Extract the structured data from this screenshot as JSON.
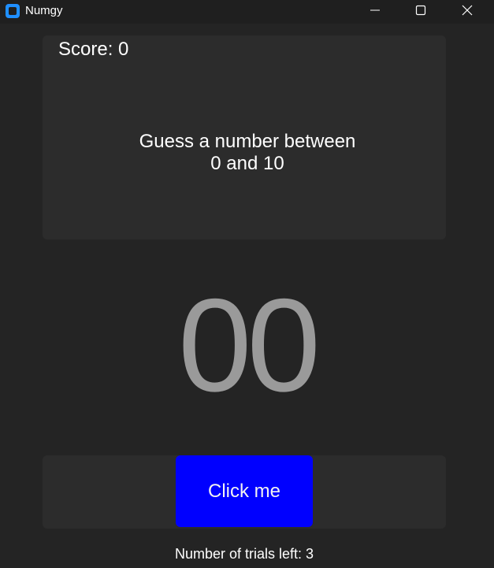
{
  "window": {
    "title": "Numgy",
    "controls": {
      "minimize_icon": "minimize-icon",
      "maximize_icon": "maximize-icon",
      "close_icon": "close-icon"
    }
  },
  "game": {
    "score_text": "Score: 0",
    "prompt_line1": "Guess a number between",
    "prompt_line2": "0 and 10",
    "number_display": "00",
    "button_label": "Click me",
    "trials_text": "Number of trials left: 3"
  },
  "colors": {
    "background": "#242424",
    "panel": "#2c2c2c",
    "button": "#0000ff",
    "number": "#9a9a9a",
    "app_icon": "#1f8fff"
  }
}
